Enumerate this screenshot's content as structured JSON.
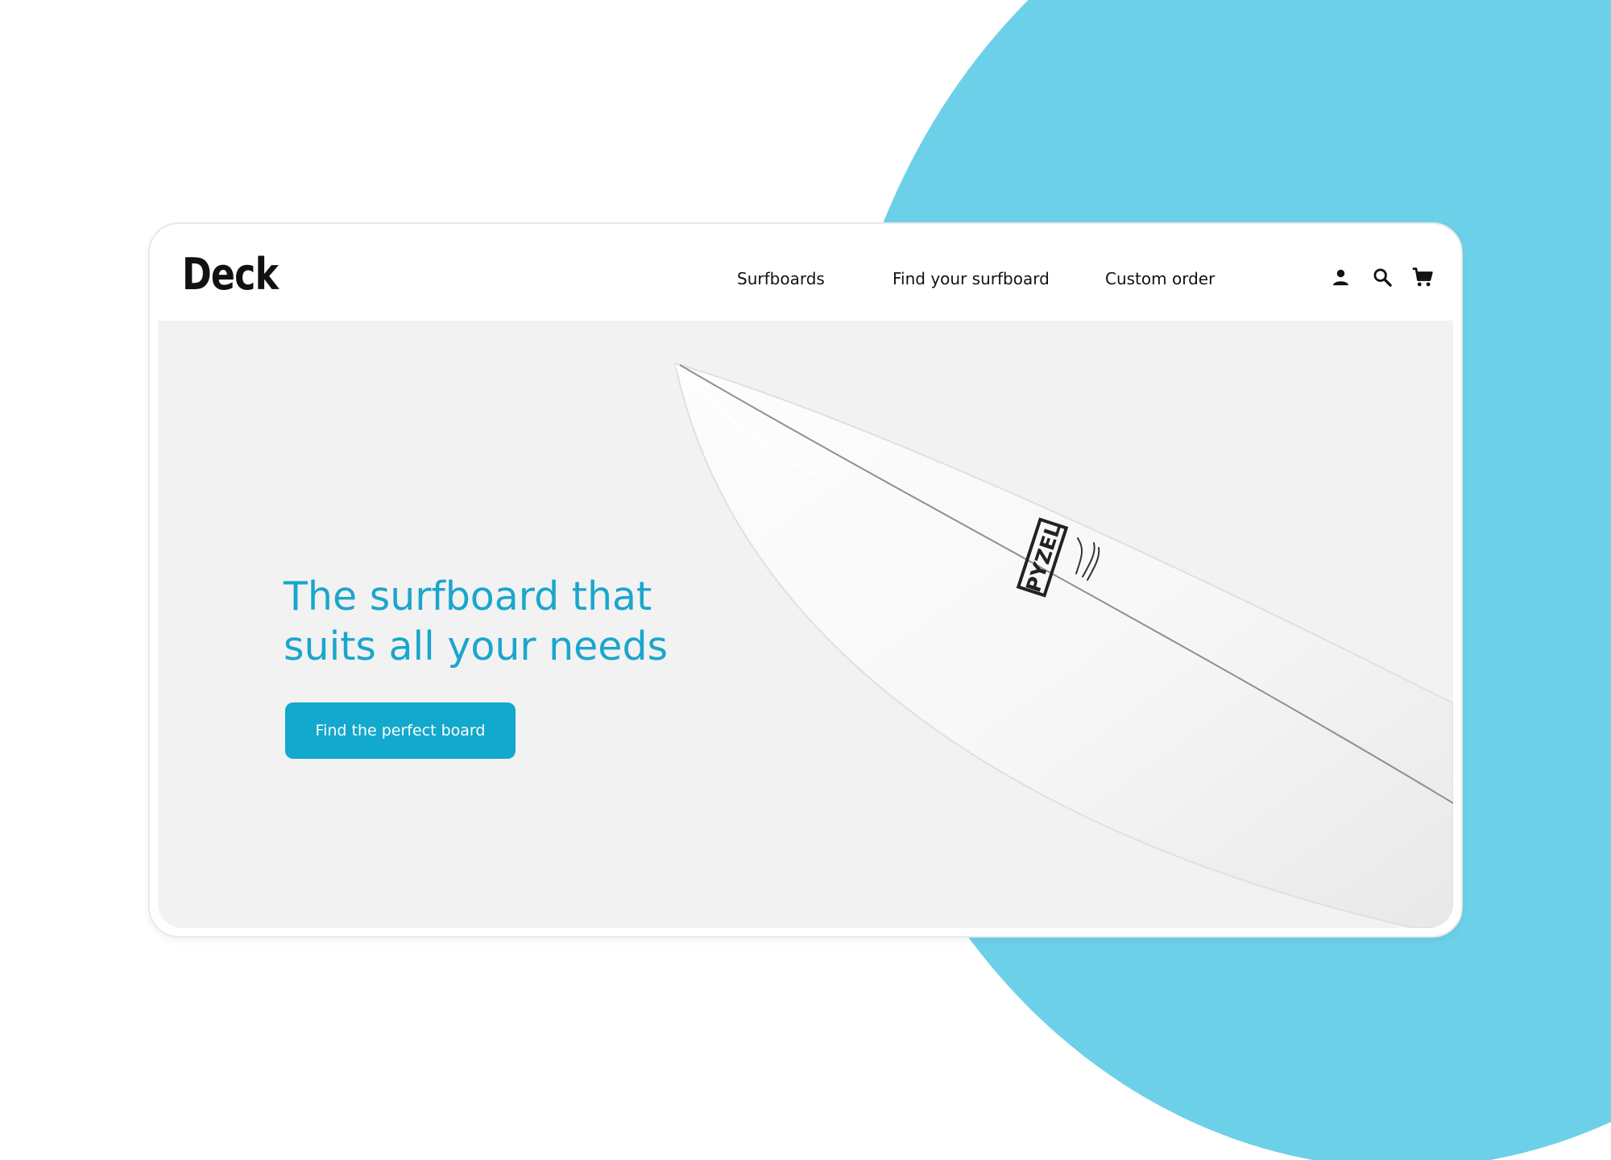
{
  "brand": {
    "logo_text": "Deck"
  },
  "nav": {
    "items": [
      {
        "label": "Surfboards"
      },
      {
        "label": "Find your surfboard"
      },
      {
        "label": "Custom order"
      }
    ],
    "icons": [
      "user-icon",
      "search-icon",
      "cart-icon"
    ]
  },
  "hero": {
    "title_line1": "The surfboard that",
    "title_line2": "suits all your needs",
    "cta_label": "Find the perfect board",
    "board_logo_text": "PYZEL"
  },
  "colors": {
    "background_accent": "#6dd0e9",
    "brand_blue": "#1aa6cc",
    "button_blue": "#13a8cd",
    "hero_background": "#f2f2f2"
  }
}
